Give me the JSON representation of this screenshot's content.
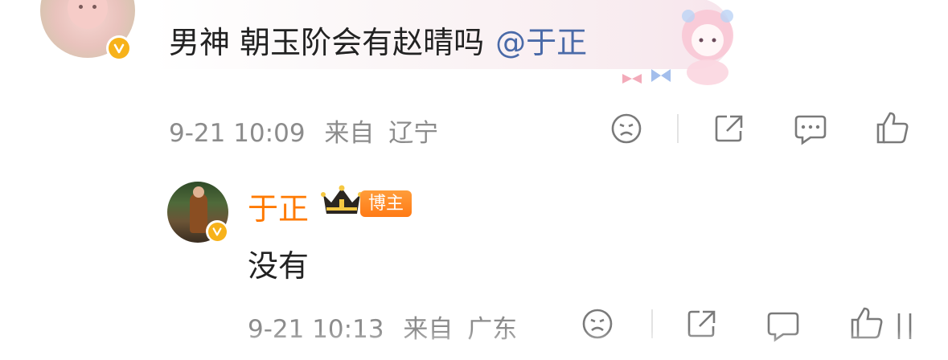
{
  "first_comment": {
    "text": "男神 朝玉阶会有赵晴吗",
    "mention": "@于正",
    "date": "9-21 10:09",
    "location_prefix": "来自",
    "location": "辽宁",
    "verified_badge": "v-badge-icon"
  },
  "reply": {
    "username": "于正",
    "badge_label": "博主",
    "crown_icon": "crown-icon",
    "text": "没有",
    "date": "9-21 10:13",
    "location_prefix": "来自",
    "location": "广东",
    "verified_badge": "v-badge-icon"
  },
  "actions": [
    "dislike-icon",
    "share-icon",
    "comment-icon",
    "like-icon"
  ],
  "colors": {
    "username": "#ff7a00",
    "mention": "#4a6aa8",
    "meta_text": "#8c8c8c",
    "verified": "#f7b21a",
    "badge": "#ff7a15"
  }
}
